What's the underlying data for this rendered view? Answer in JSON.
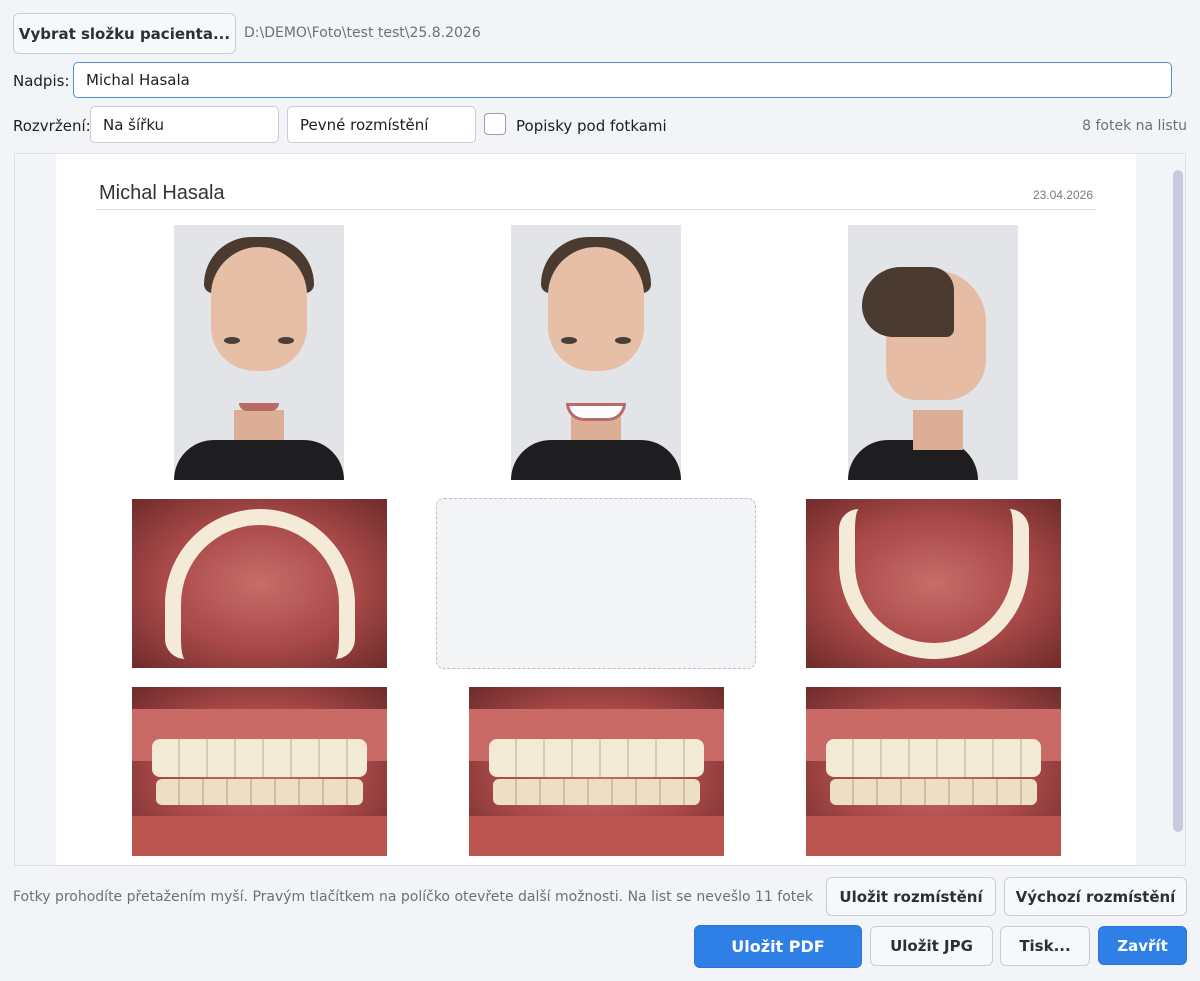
{
  "top": {
    "choose_folder_label": "Vybrat složku pacienta...",
    "folder_path": "D:\\DEMO\\Foto\\test test\\25.8.2026"
  },
  "caption_row": {
    "label": "Nadpis:",
    "value": "Michal Hasala"
  },
  "layout_row": {
    "label": "Rozvržení:",
    "orientation": "Na šířku",
    "placement": "Pevné rozmístění",
    "captions_checkbox_label": "Popisky pod fotkami",
    "captions_checked": false,
    "per_sheet": "8 fotek na listu"
  },
  "sheet": {
    "title": "Michal Hasala",
    "date": "23.04.2026"
  },
  "footer": {
    "hint": "Fotky prohodíte přetažením myší.  Pravým tlačítkem na políčko otevřete další možnosti.  Na list se nevešlo 11 fotek",
    "save_layout_label": "Uložit rozmístění",
    "default_layout_label": "Výchozí rozmístění",
    "save_pdf_label": "Uložit PDF",
    "save_jpg_label": "Uložit JPG",
    "print_label": "Tisk...",
    "close_label": "Zavřít"
  },
  "colors": {
    "accent": "#2f80e6",
    "background": "#f3f4f8"
  }
}
